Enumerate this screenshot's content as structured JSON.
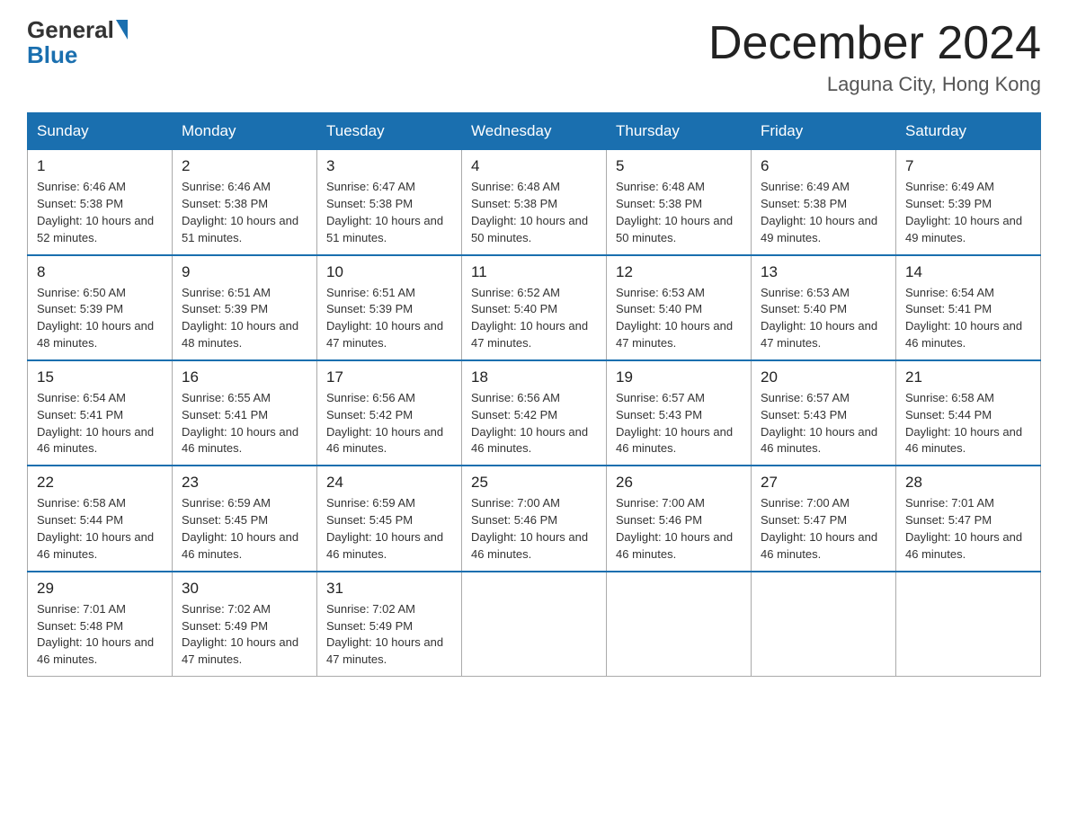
{
  "header": {
    "logo_general": "General",
    "logo_blue": "Blue",
    "month_title": "December 2024",
    "location": "Laguna City, Hong Kong"
  },
  "days_of_week": [
    "Sunday",
    "Monday",
    "Tuesday",
    "Wednesday",
    "Thursday",
    "Friday",
    "Saturday"
  ],
  "weeks": [
    [
      {
        "day": "1",
        "sunrise": "6:46 AM",
        "sunset": "5:38 PM",
        "daylight": "10 hours and 52 minutes."
      },
      {
        "day": "2",
        "sunrise": "6:46 AM",
        "sunset": "5:38 PM",
        "daylight": "10 hours and 51 minutes."
      },
      {
        "day": "3",
        "sunrise": "6:47 AM",
        "sunset": "5:38 PM",
        "daylight": "10 hours and 51 minutes."
      },
      {
        "day": "4",
        "sunrise": "6:48 AM",
        "sunset": "5:38 PM",
        "daylight": "10 hours and 50 minutes."
      },
      {
        "day": "5",
        "sunrise": "6:48 AM",
        "sunset": "5:38 PM",
        "daylight": "10 hours and 50 minutes."
      },
      {
        "day": "6",
        "sunrise": "6:49 AM",
        "sunset": "5:38 PM",
        "daylight": "10 hours and 49 minutes."
      },
      {
        "day": "7",
        "sunrise": "6:49 AM",
        "sunset": "5:39 PM",
        "daylight": "10 hours and 49 minutes."
      }
    ],
    [
      {
        "day": "8",
        "sunrise": "6:50 AM",
        "sunset": "5:39 PM",
        "daylight": "10 hours and 48 minutes."
      },
      {
        "day": "9",
        "sunrise": "6:51 AM",
        "sunset": "5:39 PM",
        "daylight": "10 hours and 48 minutes."
      },
      {
        "day": "10",
        "sunrise": "6:51 AM",
        "sunset": "5:39 PM",
        "daylight": "10 hours and 47 minutes."
      },
      {
        "day": "11",
        "sunrise": "6:52 AM",
        "sunset": "5:40 PM",
        "daylight": "10 hours and 47 minutes."
      },
      {
        "day": "12",
        "sunrise": "6:53 AM",
        "sunset": "5:40 PM",
        "daylight": "10 hours and 47 minutes."
      },
      {
        "day": "13",
        "sunrise": "6:53 AM",
        "sunset": "5:40 PM",
        "daylight": "10 hours and 47 minutes."
      },
      {
        "day": "14",
        "sunrise": "6:54 AM",
        "sunset": "5:41 PM",
        "daylight": "10 hours and 46 minutes."
      }
    ],
    [
      {
        "day": "15",
        "sunrise": "6:54 AM",
        "sunset": "5:41 PM",
        "daylight": "10 hours and 46 minutes."
      },
      {
        "day": "16",
        "sunrise": "6:55 AM",
        "sunset": "5:41 PM",
        "daylight": "10 hours and 46 minutes."
      },
      {
        "day": "17",
        "sunrise": "6:56 AM",
        "sunset": "5:42 PM",
        "daylight": "10 hours and 46 minutes."
      },
      {
        "day": "18",
        "sunrise": "6:56 AM",
        "sunset": "5:42 PM",
        "daylight": "10 hours and 46 minutes."
      },
      {
        "day": "19",
        "sunrise": "6:57 AM",
        "sunset": "5:43 PM",
        "daylight": "10 hours and 46 minutes."
      },
      {
        "day": "20",
        "sunrise": "6:57 AM",
        "sunset": "5:43 PM",
        "daylight": "10 hours and 46 minutes."
      },
      {
        "day": "21",
        "sunrise": "6:58 AM",
        "sunset": "5:44 PM",
        "daylight": "10 hours and 46 minutes."
      }
    ],
    [
      {
        "day": "22",
        "sunrise": "6:58 AM",
        "sunset": "5:44 PM",
        "daylight": "10 hours and 46 minutes."
      },
      {
        "day": "23",
        "sunrise": "6:59 AM",
        "sunset": "5:45 PM",
        "daylight": "10 hours and 46 minutes."
      },
      {
        "day": "24",
        "sunrise": "6:59 AM",
        "sunset": "5:45 PM",
        "daylight": "10 hours and 46 minutes."
      },
      {
        "day": "25",
        "sunrise": "7:00 AM",
        "sunset": "5:46 PM",
        "daylight": "10 hours and 46 minutes."
      },
      {
        "day": "26",
        "sunrise": "7:00 AM",
        "sunset": "5:46 PM",
        "daylight": "10 hours and 46 minutes."
      },
      {
        "day": "27",
        "sunrise": "7:00 AM",
        "sunset": "5:47 PM",
        "daylight": "10 hours and 46 minutes."
      },
      {
        "day": "28",
        "sunrise": "7:01 AM",
        "sunset": "5:47 PM",
        "daylight": "10 hours and 46 minutes."
      }
    ],
    [
      {
        "day": "29",
        "sunrise": "7:01 AM",
        "sunset": "5:48 PM",
        "daylight": "10 hours and 46 minutes."
      },
      {
        "day": "30",
        "sunrise": "7:02 AM",
        "sunset": "5:49 PM",
        "daylight": "10 hours and 47 minutes."
      },
      {
        "day": "31",
        "sunrise": "7:02 AM",
        "sunset": "5:49 PM",
        "daylight": "10 hours and 47 minutes."
      },
      null,
      null,
      null,
      null
    ]
  ]
}
